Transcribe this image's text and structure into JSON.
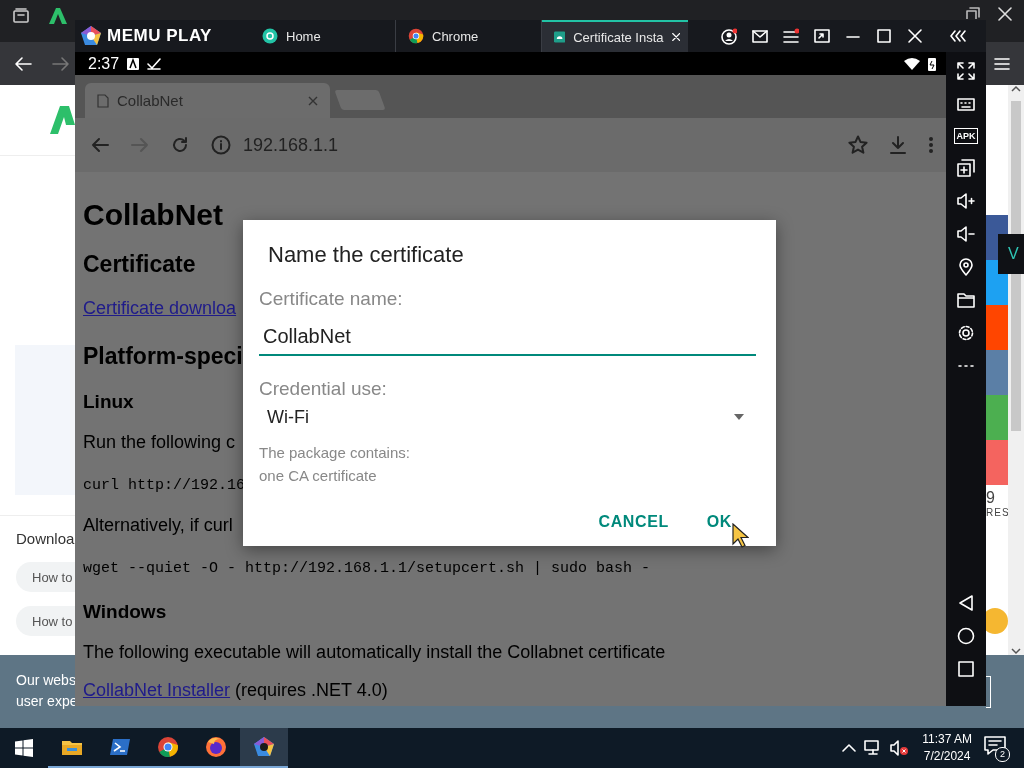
{
  "host_browser": {
    "page": {
      "section_heading": "Downloa",
      "pills": [
        "How to",
        "How to"
      ],
      "share_count": "9",
      "share_label": "RES",
      "tooltip": "V",
      "cookie_banner": [
        "Our webs",
        "user expe"
      ]
    }
  },
  "emulator": {
    "brand": "MEMU PLAY",
    "tabs": [
      {
        "label": "Home",
        "selected": false
      },
      {
        "label": "Chrome",
        "selected": false
      },
      {
        "label": "Certificate Insta",
        "selected": true
      }
    ],
    "sidebar": {
      "apk_label": "APK"
    }
  },
  "android": {
    "status_bar": {
      "time": "2:37"
    },
    "chrome": {
      "tab_title": "CollabNet",
      "url": "192.168.1.1",
      "page": [
        {
          "kind": "h1",
          "text": "CollabNet"
        },
        {
          "kind": "h2",
          "text": "Certificate"
        },
        {
          "kind": "link",
          "text": "Certificate downloa"
        },
        {
          "kind": "h2",
          "text": "Platform-speci"
        },
        {
          "kind": "h3",
          "text": "Linux"
        },
        {
          "kind": "p",
          "text": "Run the following c"
        },
        {
          "kind": "code",
          "text": "curl http://192.16"
        },
        {
          "kind": "p",
          "text": "Alternatively, if curl"
        },
        {
          "kind": "code",
          "text": "wget --quiet -O - http://192.168.1.1/setupcert.sh | sudo bash -"
        },
        {
          "kind": "h3",
          "text": "Windows"
        },
        {
          "kind": "p",
          "text": "The following executable will automatically install the Collabnet certificate"
        },
        {
          "kind": "linkp",
          "link": "CollabNet Installer",
          "text": "(requires .NET 4.0)"
        }
      ]
    },
    "dialog": {
      "title": "Name the certificate",
      "name_label": "Certificate name:",
      "name_value": "CollabNet",
      "use_label": "Credential use:",
      "use_value": "Wi-Fi",
      "info": [
        "The package contains:",
        "one CA certificate"
      ],
      "buttons": [
        "CANCEL",
        "OK"
      ]
    }
  },
  "taskbar": {
    "apps": [
      {
        "selected": false
      },
      {
        "selected": false
      },
      {
        "selected": false
      },
      {
        "selected": false
      },
      {
        "selected": true
      }
    ],
    "time": "11:37 AM",
    "date": "7/2/2024",
    "notifications": "2"
  }
}
